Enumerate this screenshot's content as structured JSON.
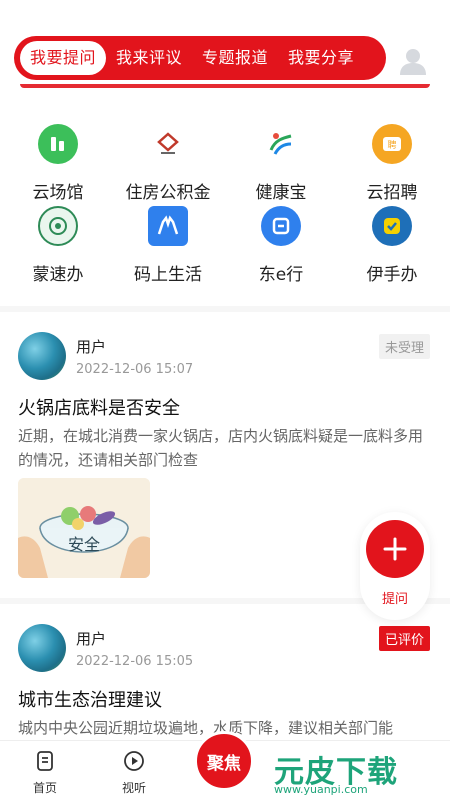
{
  "tabs": [
    "我要提问",
    "我来评议",
    "专题报道",
    "我要分享"
  ],
  "services": [
    {
      "label": "云场馆",
      "icon": "chart-icon",
      "color": "#3cbf5a"
    },
    {
      "label": "住房公积金",
      "icon": "housing-fund-logo-icon",
      "color": "#c0392b"
    },
    {
      "label": "健康宝",
      "icon": "health-logo-icon",
      "color": "#2aa65a"
    },
    {
      "label": "云招聘",
      "icon": "recruit-icon",
      "color": "#f5a623"
    },
    {
      "label": "蒙速办",
      "icon": "gov-seal-icon",
      "color": "#2e8b57"
    },
    {
      "label": "码上生活",
      "icon": "horse-icon",
      "color": "#2f80ed"
    },
    {
      "label": "东e行",
      "icon": "travel-icon",
      "color": "#2f80ed"
    },
    {
      "label": "伊手办",
      "icon": "yi-shou-ban-icon",
      "color": "#1e6fb8"
    }
  ],
  "posts": [
    {
      "user": "用户",
      "time": "2022-12-06 15:07",
      "status": "未受理",
      "title": "火锅店底料是否安全",
      "body": "近期，在城北消费一家火锅店，店内火锅底料疑是一底料多用的情况，还请相关部门检查",
      "image_text": "安全"
    },
    {
      "user": "用户",
      "time": "2022-12-06 15:05",
      "status": "已评价",
      "title": "城市生态治理建议",
      "body": "城内中央公园近期垃圾遍地，水质下降，建议相关部门能"
    }
  ],
  "fab": {
    "label": "提问"
  },
  "nav": {
    "home": "首页",
    "video": "视听",
    "focus": "聚焦"
  },
  "watermark": {
    "big": "元皮下载",
    "small": "www.yuanpi.com"
  }
}
